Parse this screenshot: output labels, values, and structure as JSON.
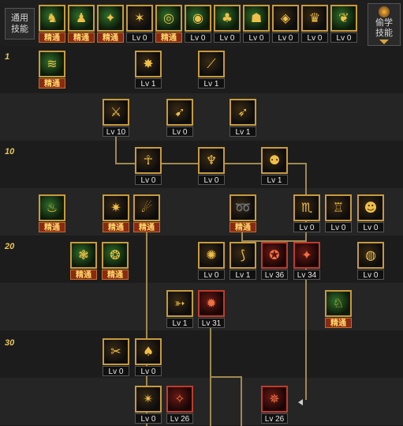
{
  "topbar": {
    "general_skills_label": "通用\n技能",
    "steal_skills_label": "偷学\n技能",
    "skills": [
      {
        "glyph": "♞",
        "caption": "精通",
        "style": "green"
      },
      {
        "glyph": "♟",
        "caption": "精通",
        "style": "green"
      },
      {
        "glyph": "✦",
        "caption": "精通",
        "style": "green"
      },
      {
        "glyph": "✶",
        "caption": "Lv 0",
        "style": "gold"
      },
      {
        "glyph": "◎",
        "caption": "精通",
        "style": "green"
      },
      {
        "glyph": "◉",
        "caption": "Lv 0",
        "style": "green"
      },
      {
        "glyph": "♣",
        "caption": "Lv 0",
        "style": "green"
      },
      {
        "glyph": "☗",
        "caption": "Lv 0",
        "style": "green"
      },
      {
        "glyph": "◈",
        "caption": "Lv 0",
        "style": "gold"
      },
      {
        "glyph": "♛",
        "caption": "Lv 0",
        "style": "gold"
      },
      {
        "glyph": "❦",
        "caption": "Lv 0",
        "style": "green"
      }
    ]
  },
  "level_markers": [
    "1",
    "10",
    "20",
    "30"
  ],
  "tree_skills": [
    {
      "glyph": "≋",
      "caption": "精通",
      "style": "green"
    },
    {
      "glyph": "✸",
      "caption": "Lv 1",
      "style": "gold"
    },
    {
      "glyph": "⟋",
      "caption": "Lv 1",
      "style": "gold"
    },
    {
      "glyph": "⚔",
      "caption": "Lv 10",
      "style": "gold"
    },
    {
      "glyph": "➹",
      "caption": "Lv 0",
      "style": "gold"
    },
    {
      "glyph": "➶",
      "caption": "Lv 1",
      "style": "gold"
    },
    {
      "glyph": "☥",
      "caption": "Lv 0",
      "style": "gold"
    },
    {
      "glyph": "♆",
      "caption": "Lv 0",
      "style": "gold"
    },
    {
      "glyph": "⚉",
      "caption": "Lv 1",
      "style": "gold"
    },
    {
      "glyph": "♨",
      "caption": "精通",
      "style": "green"
    },
    {
      "glyph": "✷",
      "caption": "精通",
      "style": "gold"
    },
    {
      "glyph": "☄",
      "caption": "精通",
      "style": "gold"
    },
    {
      "glyph": "➿",
      "caption": "精通",
      "style": "gold"
    },
    {
      "glyph": "♏",
      "caption": "Lv 0",
      "style": "gold"
    },
    {
      "glyph": "♖",
      "caption": "Lv 0",
      "style": "gold"
    },
    {
      "glyph": "☻",
      "caption": "Lv 0",
      "style": "gold"
    },
    {
      "glyph": "❃",
      "caption": "精通",
      "style": "green"
    },
    {
      "glyph": "❂",
      "caption": "精通",
      "style": "green"
    },
    {
      "glyph": "✺",
      "caption": "Lv 0",
      "style": "gold"
    },
    {
      "glyph": "⟆",
      "caption": "Lv 1",
      "style": "gold"
    },
    {
      "glyph": "✪",
      "caption": "Lv 36",
      "style": "red"
    },
    {
      "glyph": "✦",
      "caption": "Lv 34",
      "style": "red"
    },
    {
      "glyph": "◍",
      "caption": "Lv 0",
      "style": "gold"
    },
    {
      "glyph": "➳",
      "caption": "Lv 1",
      "style": "gold"
    },
    {
      "glyph": "✹",
      "caption": "Lv 31",
      "style": "red"
    },
    {
      "glyph": "♘",
      "caption": "精通",
      "style": "green"
    },
    {
      "glyph": "✂",
      "caption": "Lv 0",
      "style": "gold"
    },
    {
      "glyph": "♠",
      "caption": "Lv 0",
      "style": "gold"
    },
    {
      "glyph": "✴",
      "caption": "Lv 0",
      "style": "gold"
    },
    {
      "glyph": "✧",
      "caption": "Lv 26",
      "style": "red"
    },
    {
      "glyph": "✵",
      "caption": "Lv 26",
      "style": "red"
    }
  ],
  "colors": {
    "gold_border": "#c89a3c",
    "red_border": "#c23a2a",
    "mastered_caption_bg": "#8a2a12",
    "connector": "#a08850",
    "level_marker": "#e8c65a"
  }
}
